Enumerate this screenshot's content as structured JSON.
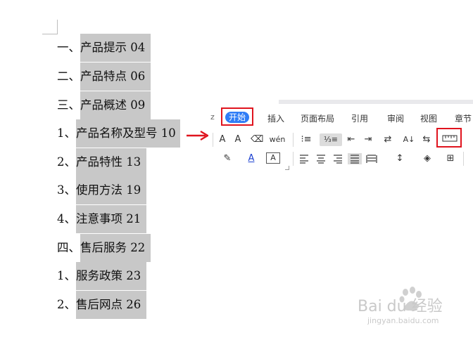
{
  "toc": [
    {
      "prefix": "一、",
      "text": "产品提示 04"
    },
    {
      "prefix": "二、",
      "text": "产品特点 06"
    },
    {
      "prefix": "三、",
      "text": "产品概述 09"
    },
    {
      "prefix": "1、",
      "text": "产品名称及型号 10"
    },
    {
      "prefix": "2、",
      "text": "产品特性 13"
    },
    {
      "prefix": "3、",
      "text": "使用方法 19"
    },
    {
      "prefix": "4、",
      "text": "注意事项 21"
    },
    {
      "prefix": "四、",
      "text": "售后服务 22"
    },
    {
      "prefix": "1、",
      "text": "服务政策 23"
    },
    {
      "prefix": "2、",
      "text": "售后网点 26"
    }
  ],
  "ribbon": {
    "stub": "z",
    "active_tab": "开始",
    "tabs": [
      "插入",
      "页面布局",
      "引用",
      "审阅",
      "视图",
      "章节"
    ],
    "row1": {
      "grow": "A",
      "shrink": "A",
      "eraser": "⌫",
      "phonetic": "wén",
      "bullets": "⁝≡",
      "numbering": "⅓≡",
      "outdent": "⇤",
      "indent": "⇥",
      "chinese_layout": "⇄",
      "sort": "A↓",
      "swap": "⇆"
    },
    "row2": {
      "highlight": "✎",
      "font_color": "A",
      "char_border": "A",
      "line_spacing": "↕",
      "shading": "◈",
      "borders": "⊞"
    }
  },
  "colors": {
    "highlight": "#c8c8c8",
    "accent": "#2f7df6",
    "callout": "#e0141e"
  },
  "watermark": {
    "brand": "Bai du 经验",
    "url": "jingyan.baidu.com"
  }
}
